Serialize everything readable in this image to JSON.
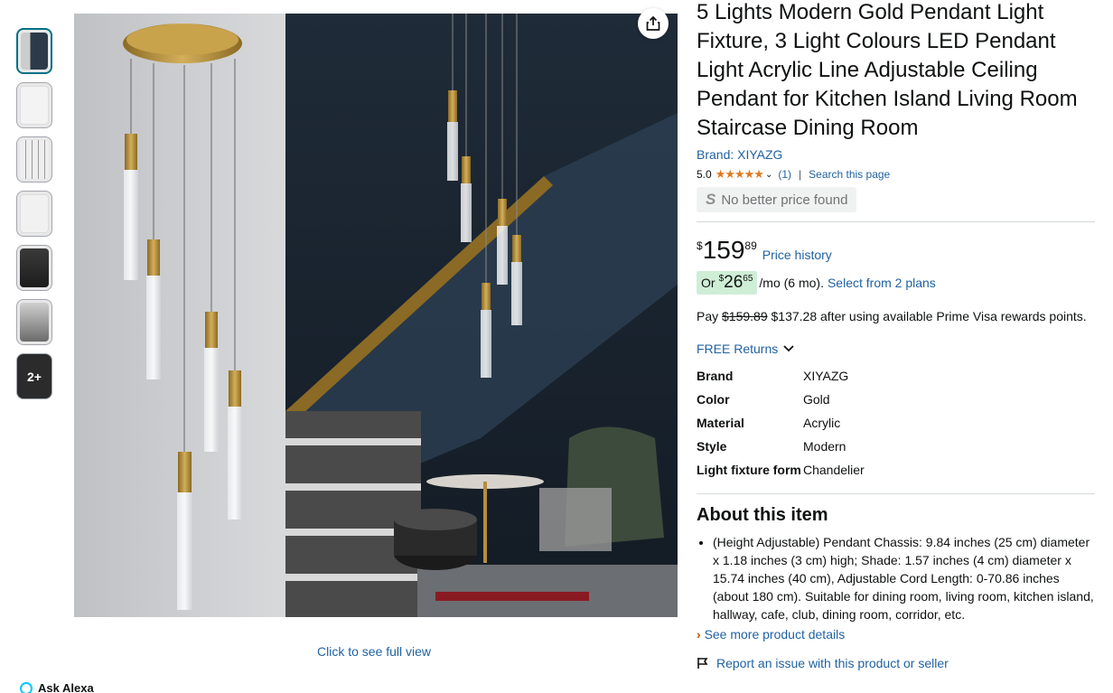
{
  "thumbnails": [
    {
      "name": "thumb-1",
      "active": true
    },
    {
      "name": "thumb-2",
      "active": false
    },
    {
      "name": "thumb-3",
      "active": false
    },
    {
      "name": "thumb-4",
      "active": false
    },
    {
      "name": "thumb-5",
      "active": false
    },
    {
      "name": "thumb-6",
      "active": false
    }
  ],
  "more_thumbs_label": "2+",
  "image_caption": "Click to see full view",
  "ask_alexa": "Ask Alexa",
  "product": {
    "title": "5 Lights Modern Gold Pendant Light Fixture, 3 Light Colours LED Pendant Light Acrylic Line Adjustable Ceiling Pendant for Kitchen Island Living Room Staircase Dining Room",
    "brand_link": "Brand: XIYAZG",
    "rating": "5.0",
    "stars": "★★★★★",
    "review_count": "(1)",
    "search_page": "Search this page",
    "no_better_price": "No better price found",
    "price": {
      "symbol": "$",
      "whole": "159",
      "fraction": "89"
    },
    "price_history": "Price history",
    "installment": {
      "or": "Or",
      "symbol": "$",
      "whole": "26",
      "fraction": "65",
      "term": "/mo (6 mo).",
      "select_plans": "Select from 2 plans"
    },
    "pay": {
      "prefix": "Pay",
      "original": "$159.89",
      "discounted": "$137.28",
      "suffix": "after using available Prime Visa rewards points."
    },
    "free_returns": "FREE Returns",
    "specs": [
      {
        "key": "Brand",
        "value": "XIYAZG"
      },
      {
        "key": "Color",
        "value": "Gold"
      },
      {
        "key": "Material",
        "value": "Acrylic"
      },
      {
        "key": "Style",
        "value": "Modern"
      },
      {
        "key": "Light fixture form",
        "value": "Chandelier"
      }
    ],
    "about_title": "About this item",
    "about_bullets": [
      "(Height Adjustable) Pendant Chassis: 9.84 inches (25 cm) diameter x 1.18 inches (3 cm) high; Shade: 1.57 inches (4 cm) diameter x 15.74 inches (40 cm), Adjustable Cord Length: 0-70.86 inches (about 180 cm). Suitable for dining room, living room, kitchen island, hallway, cafe, club, dining room, corridor, etc."
    ],
    "see_more": "See more product details",
    "report": "Report an issue with this product or seller"
  },
  "colors": {
    "link": "#2162a1",
    "star": "#de7921",
    "installment_bg": "#cfeed6",
    "brass": "#b8913a"
  },
  "icons": [
    "share-icon",
    "chevron-down-icon",
    "flag-icon",
    "alexa-icon",
    "s-logo-icon"
  ]
}
